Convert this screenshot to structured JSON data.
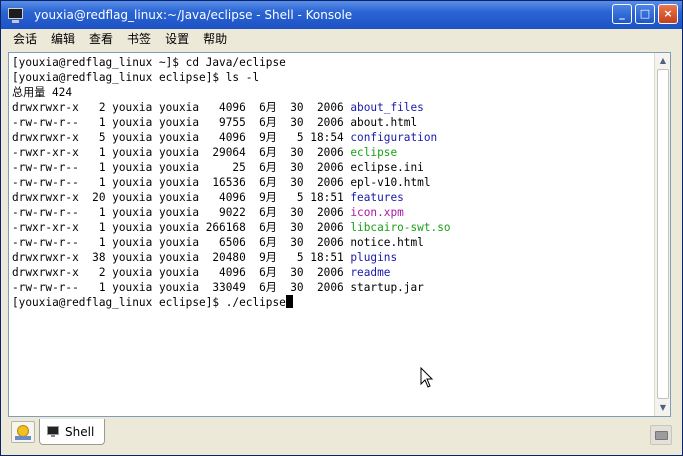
{
  "window": {
    "title": "youxia@redflag_linux:~/Java/eclipse - Shell - Konsole",
    "buttons": {
      "minimize": "_",
      "maximize": "□",
      "close": "×"
    }
  },
  "menu": {
    "items": [
      "会话",
      "编辑",
      "查看",
      "书签",
      "设置",
      "帮助"
    ]
  },
  "terminal": {
    "lines": [
      {
        "text": "[youxia@redflag_linux ~]$ cd Java/eclipse"
      },
      {
        "text": "[youxia@redflag_linux eclipse]$ ls -l"
      },
      {
        "text": "总用量 424"
      },
      {
        "prefix": "drwxrwxr-x   2 youxia youxia   4096  6月  30  2006 ",
        "name": "about_files",
        "color": "blue"
      },
      {
        "prefix": "-rw-rw-r--   1 youxia youxia   9755  6月  30  2006 ",
        "name": "about.html",
        "color": "default"
      },
      {
        "prefix": "drwxrwxr-x   5 youxia youxia   4096  9月   5 18:54 ",
        "name": "configuration",
        "color": "blue"
      },
      {
        "prefix": "-rwxr-xr-x   1 youxia youxia  29064  6月  30  2006 ",
        "name": "eclipse",
        "color": "green"
      },
      {
        "prefix": "-rw-rw-r--   1 youxia youxia     25  6月  30  2006 ",
        "name": "eclipse.ini",
        "color": "default"
      },
      {
        "prefix": "-rw-rw-r--   1 youxia youxia  16536  6月  30  2006 ",
        "name": "epl-v10.html",
        "color": "default"
      },
      {
        "prefix": "drwxrwxr-x  20 youxia youxia   4096  9月   5 18:51 ",
        "name": "features",
        "color": "blue"
      },
      {
        "prefix": "-rw-rw-r--   1 youxia youxia   9022  6月  30  2006 ",
        "name": "icon.xpm",
        "color": "magenta"
      },
      {
        "prefix": "-rwxr-xr-x   1 youxia youxia 266168  6月  30  2006 ",
        "name": "libcairo-swt.so",
        "color": "green"
      },
      {
        "prefix": "-rw-rw-r--   1 youxia youxia   6506  6月  30  2006 ",
        "name": "notice.html",
        "color": "default"
      },
      {
        "prefix": "drwxrwxr-x  38 youxia youxia  20480  9月   5 18:51 ",
        "name": "plugins",
        "color": "blue"
      },
      {
        "prefix": "drwxrwxr-x   2 youxia youxia   4096  6月  30  2006 ",
        "name": "readme",
        "color": "blue"
      },
      {
        "prefix": "-rw-rw-r--   1 youxia youxia  33049  6月  30  2006 ",
        "name": "startup.jar",
        "color": "default"
      },
      {
        "text": "[youxia@redflag_linux eclipse]$ ./eclipse",
        "cursor": true
      }
    ]
  },
  "tabs": [
    {
      "label": "Shell",
      "active": true
    }
  ],
  "colors": {
    "blue": "#1a1aa8",
    "green": "#18a018",
    "magenta": "#a818a8",
    "titlebar": "#2a64d4",
    "chrome": "#ece9d8"
  },
  "icons": {
    "app": "konsole-monitor-icon",
    "new_session": "new-session-icon",
    "tab": "terminal-tab-icon",
    "close_session": "close-session-icon"
  }
}
